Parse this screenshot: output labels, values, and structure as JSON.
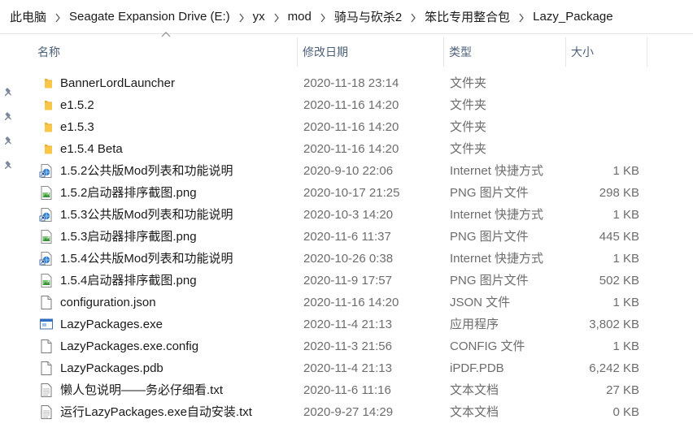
{
  "breadcrumb": [
    "此电脑",
    "Seagate Expansion Drive (E:)",
    "yx",
    "mod",
    "骑马与砍杀2",
    "笨比专用整合包",
    "Lazy_Package"
  ],
  "columns": {
    "name": "名称",
    "modified": "修改日期",
    "type": "类型",
    "size": "大小"
  },
  "files": [
    {
      "name": "BannerLordLauncher",
      "modified": "2020-11-18 23:14",
      "type": "文件夹",
      "size": "",
      "icon": "folder-icon"
    },
    {
      "name": "e1.5.2",
      "modified": "2020-11-16 14:20",
      "type": "文件夹",
      "size": "",
      "icon": "folder-icon"
    },
    {
      "name": "e1.5.3",
      "modified": "2020-11-16 14:20",
      "type": "文件夹",
      "size": "",
      "icon": "folder-icon"
    },
    {
      "name": "e1.5.4 Beta",
      "modified": "2020-11-16 14:20",
      "type": "文件夹",
      "size": "",
      "icon": "folder-icon"
    },
    {
      "name": "1.5.2公共版Mod列表和功能说明",
      "modified": "2020-9-10 22:06",
      "type": "Internet 快捷方式",
      "size": "1 KB",
      "icon": "internet-shortcut-icon"
    },
    {
      "name": "1.5.2启动器排序截图.png",
      "modified": "2020-10-17 21:25",
      "type": "PNG 图片文件",
      "size": "298 KB",
      "icon": "png-image-icon"
    },
    {
      "name": "1.5.3公共版Mod列表和功能说明",
      "modified": "2020-10-3 14:20",
      "type": "Internet 快捷方式",
      "size": "1 KB",
      "icon": "internet-shortcut-icon"
    },
    {
      "name": "1.5.3启动器排序截图.png",
      "modified": "2020-11-6 11:37",
      "type": "PNG 图片文件",
      "size": "445 KB",
      "icon": "png-image-icon"
    },
    {
      "name": "1.5.4公共版Mod列表和功能说明",
      "modified": "2020-10-26 0:38",
      "type": "Internet 快捷方式",
      "size": "1 KB",
      "icon": "internet-shortcut-icon"
    },
    {
      "name": "1.5.4启动器排序截图.png",
      "modified": "2020-11-9 17:57",
      "type": "PNG 图片文件",
      "size": "502 KB",
      "icon": "png-image-icon"
    },
    {
      "name": "configuration.json",
      "modified": "2020-11-16 14:20",
      "type": "JSON 文件",
      "size": "1 KB",
      "icon": "generic-file-icon"
    },
    {
      "name": "LazyPackages.exe",
      "modified": "2020-11-4 21:13",
      "type": "应用程序",
      "size": "3,802 KB",
      "icon": "application-icon"
    },
    {
      "name": "LazyPackages.exe.config",
      "modified": "2020-11-3 21:56",
      "type": "CONFIG 文件",
      "size": "1 KB",
      "icon": "generic-file-icon"
    },
    {
      "name": "LazyPackages.pdb",
      "modified": "2020-11-4 21:13",
      "type": "iPDF.PDB",
      "size": "6,242 KB",
      "icon": "generic-file-icon"
    },
    {
      "name": "懒人包说明——务必仔细看.txt",
      "modified": "2020-11-6 11:16",
      "type": "文本文档",
      "size": "27 KB",
      "icon": "text-file-icon"
    },
    {
      "name": "运行LazyPackages.exe自动安装.txt",
      "modified": "2020-9-27 14:29",
      "type": "文本文档",
      "size": "0 KB",
      "icon": "text-file-icon"
    }
  ],
  "colors": {
    "header_text": "#4c607a",
    "meta_text": "#6d6d6d",
    "folder": "#f8c74a"
  }
}
